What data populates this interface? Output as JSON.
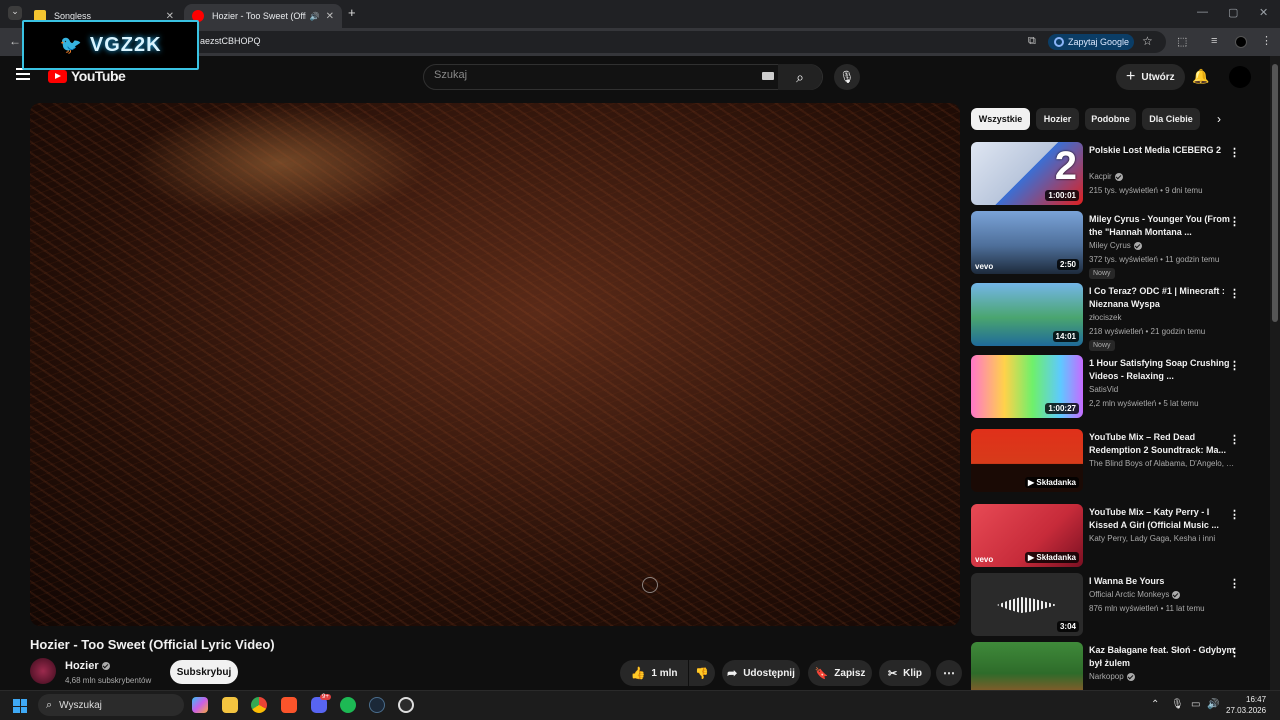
{
  "browser": {
    "tabs": [
      {
        "title": "Songless",
        "close": "✕",
        "favicon_color": "#f4c430"
      },
      {
        "title": "Hozier - Too Sweet (Official",
        "close": "✕",
        "favicon_color": "#ff0000",
        "audio_icon": "🔊"
      }
    ],
    "new_tab": "+",
    "tab_menu": "⌄",
    "window_controls": {
      "minimize": "—",
      "maximize": "▢",
      "close": "✕"
    },
    "address_bar": "aezstCBHOPQ",
    "ask_google": "Zapytaj Google"
  },
  "overlay_logo": {
    "text": "VGZ2K",
    "bird": "🐦"
  },
  "youtube": {
    "brand": "YouTube",
    "region": "PL",
    "search_placeholder": "Szukaj",
    "create_label": "Utwórz",
    "video": {
      "title": "Hozier - Too Sweet (Official Lyric Video)",
      "channel": "Hozier",
      "subscribers": "4,68 mln subskrybentów",
      "subscribe_label": "Subskrybuj",
      "likes": "1 mln",
      "share_label": "Udostępnij",
      "save_label": "Zapisz",
      "clip_label": "Klip",
      "more": "⋯"
    },
    "chips": [
      "Wszystkie",
      "Hozier",
      "Podobne",
      "Dla Ciebie"
    ],
    "recommendations": [
      {
        "title": "Polskie Lost Media ICEBERG 2",
        "channel": "Kacpir",
        "verified": true,
        "meta": "215 tys. wyświetleń • 9 dni temu",
        "duration": "1:00:01",
        "thumb_color": "#3b6fd4",
        "new": ""
      },
      {
        "title": "Miley Cyrus - Younger You (From the \"Hannah Montana ...",
        "channel": "Miley Cyrus",
        "verified": true,
        "meta": "372 tys. wyświetleń • 11 godzin temu",
        "duration": "2:50",
        "thumb_color": "#5b85b5",
        "new": "Nowy",
        "vevo": "vevo"
      },
      {
        "title": "I Co Teraz? ODC #1 | Minecraft : Nieznana Wyspa",
        "channel": "złociszek",
        "verified": false,
        "meta": "218 wyświetleń • 21 godzin temu",
        "duration": "14:01",
        "thumb_color": "#3a9b6a",
        "new": "Nowy"
      },
      {
        "title": "1 Hour Satisfying Soap Crushing Videos - Relaxing ...",
        "channel": "SatisVid",
        "verified": false,
        "meta": "2,2 mln wyświetleń • 5 lat temu",
        "duration": "1:00:27",
        "thumb_color": "#d24fa8",
        "new": ""
      },
      {
        "title": "YouTube Mix – Red Dead Redemption 2 Soundtrack: Ma...",
        "channel": "The Blind Boys of Alabama, D'Angelo, Da...",
        "verified": false,
        "meta": "",
        "duration": "Składanka",
        "thumb_color": "#c53018",
        "new": ""
      },
      {
        "title": "YouTube Mix – Katy Perry - I Kissed A Girl (Official Music ...",
        "channel": "Katy Perry, Lady Gaga, Kesha i inni",
        "verified": false,
        "meta": "",
        "duration": "Składanka",
        "thumb_color": "#d33a48",
        "new": "",
        "vevo": "vevo"
      },
      {
        "title": "I Wanna Be Yours",
        "channel": "Official Arctic Monkeys",
        "verified": true,
        "meta": "876 mln wyświetleń • 11 lat temu",
        "duration": "3:04",
        "thumb_color": "#2a2a2a",
        "new": ""
      },
      {
        "title": "Kaz Bałagane feat. Słoń - Gdybym był żulem",
        "channel": "Narkopop",
        "verified": true,
        "meta": "",
        "duration": "",
        "thumb_color": "#2e6b2a",
        "new": ""
      }
    ]
  },
  "taskbar": {
    "search_label": "Wyszukaj",
    "time": "16:47",
    "date": "27.03.2026",
    "discord_badge": "9+"
  }
}
